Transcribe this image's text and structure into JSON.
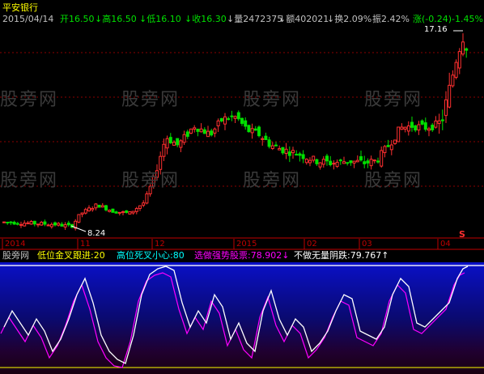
{
  "title": "平安银行",
  "info": {
    "date": "2015/04/14",
    "open": "开16.50",
    "high": "↓高16.50",
    "low": "↓低16.10",
    "close": "↓收16.30",
    "vol": "↓量2472375",
    "amount": "↓额402021",
    "turnover": "↓换2.09%",
    "amplitude": "振2.42%",
    "change": "涨(-0.24)-1.45%"
  },
  "price_labels": {
    "max": "17.16",
    "min": "8.24",
    "marker": "S"
  },
  "dates": [
    "2014",
    "11",
    "12",
    "2015",
    "02",
    "03",
    "04"
  ],
  "indicator": {
    "name": "股旁网",
    "items": [
      {
        "text": "低位金叉跟进:20",
        "color": "#ffff00"
      },
      {
        "text": "高位死叉小心:80",
        "color": "#00ffff"
      },
      {
        "text": "选做强势股票:78.902↓",
        "color": "#ff00ff"
      },
      {
        "text": "不做无量阴跌:79.767↑",
        "color": "#ffffff"
      }
    ]
  },
  "watermark": "股旁网",
  "chart_data": {
    "type": "candlestick",
    "price_range": [
      8.24,
      17.16
    ],
    "last_close": 16.3
  }
}
